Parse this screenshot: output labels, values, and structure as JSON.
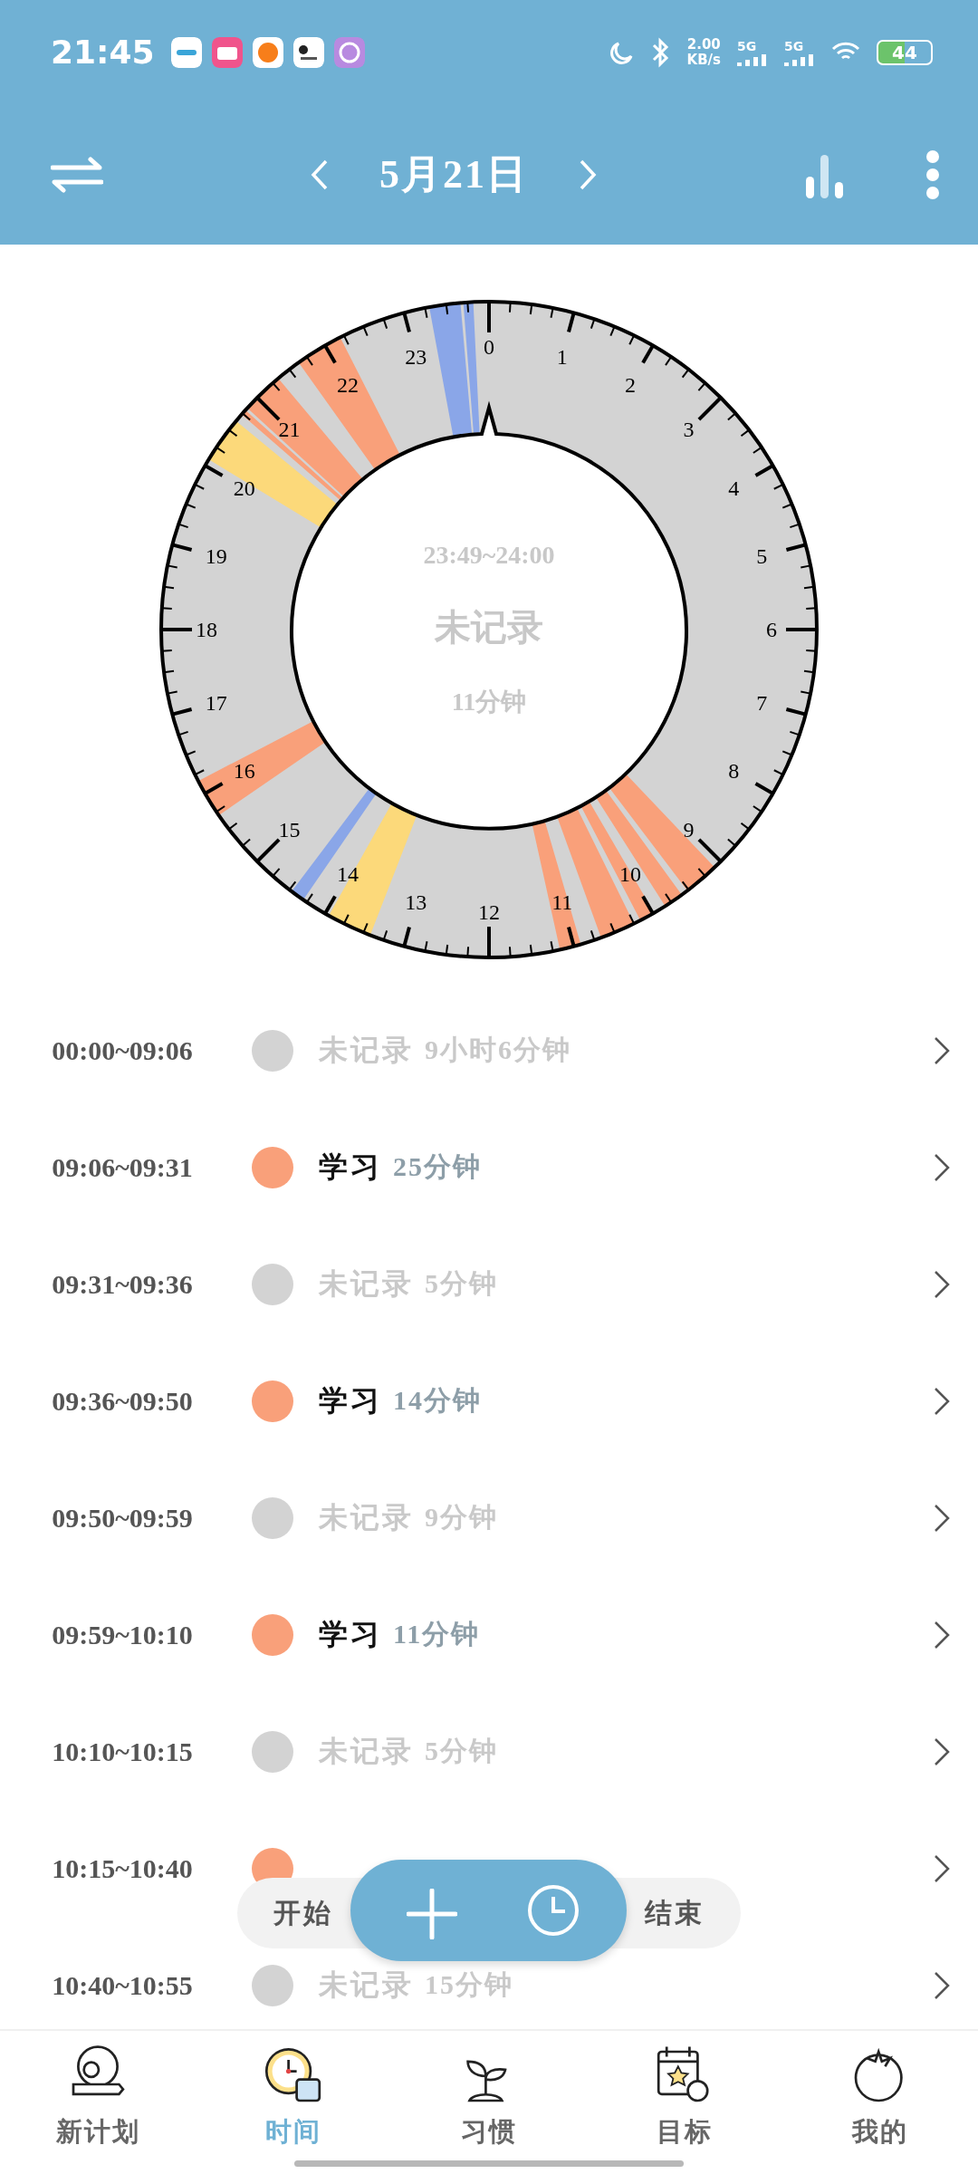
{
  "status_bar": {
    "time": "21:45",
    "net_speed": "2.00",
    "net_unit": "KB/s",
    "signal_labels": [
      "5G",
      "5G"
    ],
    "battery": "44"
  },
  "toolbar": {
    "date": "5月21日"
  },
  "ring": {
    "hours": [
      "0",
      "1",
      "2",
      "3",
      "4",
      "5",
      "6",
      "7",
      "8",
      "9",
      "10",
      "11",
      "12",
      "13",
      "14",
      "15",
      "16",
      "17",
      "18",
      "19",
      "20",
      "21",
      "22",
      "23"
    ],
    "center": {
      "range": "23:49~24:00",
      "name": "未记录",
      "duration": "11分钟"
    }
  },
  "records": [
    {
      "kind": "unrecorded",
      "time": "00:00~09:06",
      "color": "#d3d3d3",
      "name": "未记录",
      "duration": "9小时6分钟"
    },
    {
      "kind": "activity",
      "time": "09:06~09:31",
      "color": "#f9a07a",
      "name": "学习",
      "duration": "25分钟"
    },
    {
      "kind": "unrecorded",
      "time": "09:31~09:36",
      "color": "#d3d3d3",
      "name": "未记录",
      "duration": "5分钟"
    },
    {
      "kind": "activity",
      "time": "09:36~09:50",
      "color": "#f9a07a",
      "name": "学习",
      "duration": "14分钟"
    },
    {
      "kind": "unrecorded",
      "time": "09:50~09:59",
      "color": "#d3d3d3",
      "name": "未记录",
      "duration": "9分钟"
    },
    {
      "kind": "activity",
      "time": "09:59~10:10",
      "color": "#f9a07a",
      "name": "学习",
      "duration": "11分钟"
    },
    {
      "kind": "unrecorded",
      "time": "10:10~10:15",
      "color": "#d3d3d3",
      "name": "未记录",
      "duration": "5分钟"
    },
    {
      "kind": "activity",
      "time": "10:15~10:40",
      "color": "#f9a07a"
    },
    {
      "kind": "unrecorded",
      "time": "10:40~10:55",
      "color": "#d3d3d3",
      "name": "未记录",
      "duration": "15分钟"
    }
  ],
  "action_bar": {
    "start": "开始",
    "end": "结束"
  },
  "bottom_nav": [
    {
      "label": "新计划",
      "selected": false
    },
    {
      "label": "时间",
      "selected": true
    },
    {
      "label": "习惯",
      "selected": false
    },
    {
      "label": "目标",
      "selected": false
    },
    {
      "label": "我的",
      "selected": false
    }
  ]
}
